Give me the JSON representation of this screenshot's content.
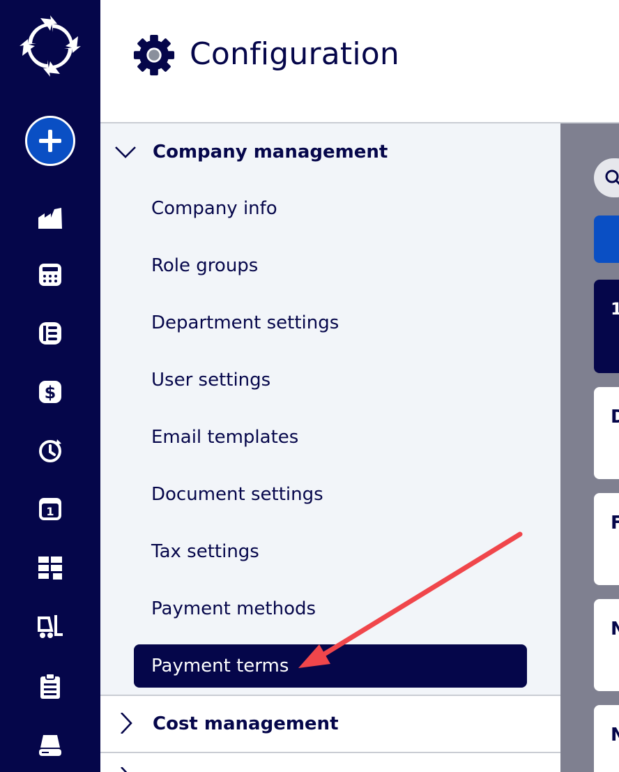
{
  "header": {
    "title": "Configuration"
  },
  "rail": {
    "logo": "refresh-cycle-logo",
    "add_icon": "plus-icon",
    "items": [
      {
        "icon": "factory-icon"
      },
      {
        "icon": "calculator-icon"
      },
      {
        "icon": "ledger-icon"
      },
      {
        "icon": "dollar-icon"
      },
      {
        "icon": "clock-history-icon"
      },
      {
        "icon": "calendar-icon",
        "text": "1"
      },
      {
        "icon": "grid-icon"
      },
      {
        "icon": "forklift-icon"
      },
      {
        "icon": "clipboard-icon"
      },
      {
        "icon": "stamp-icon"
      }
    ]
  },
  "menu": {
    "sections": [
      {
        "label": "Company management",
        "expanded": true,
        "items": [
          "Company info",
          "Role groups",
          "Department settings",
          "User settings",
          "Email templates",
          "Document settings",
          "Tax settings",
          "Payment methods",
          "Payment terms"
        ],
        "active_item": "Payment terms"
      },
      {
        "label": "Cost management",
        "expanded": false
      }
    ]
  },
  "content": {
    "dark_card_text": "1",
    "cards": [
      "D",
      "F",
      "N",
      "N"
    ]
  },
  "colors": {
    "rail": "#05064a",
    "accent": "#0a4fc4",
    "panel": "#f2f5f9",
    "content_bg": "#7f8090",
    "annotation_arrow": "#f0464b"
  }
}
